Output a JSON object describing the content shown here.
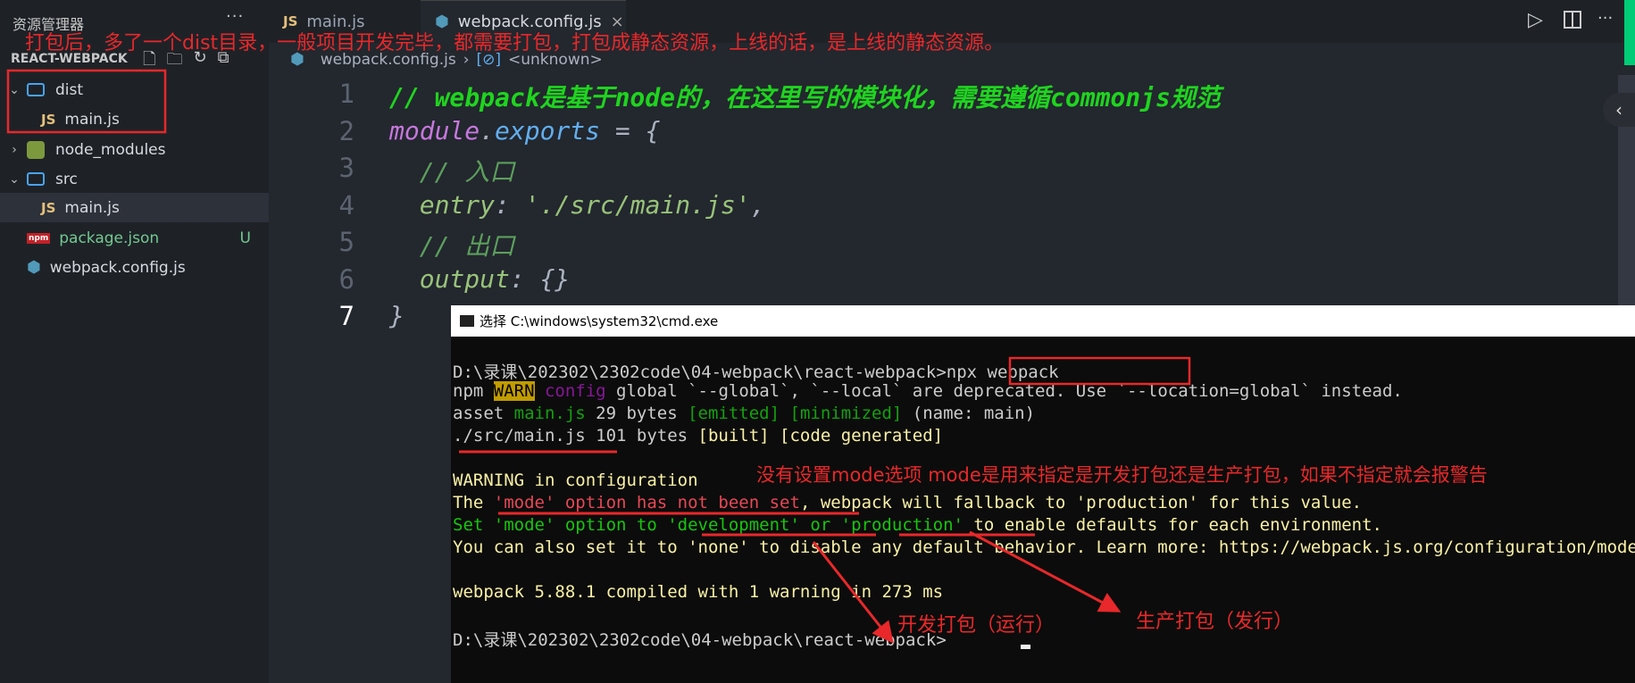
{
  "sidebar": {
    "title": "资源管理器",
    "more": "···",
    "project": "REACT-WEBPACK",
    "items": [
      {
        "label": "dist",
        "type": "folder",
        "expanded": true
      },
      {
        "label": "main.js",
        "type": "js"
      },
      {
        "label": "node_modules",
        "type": "node"
      },
      {
        "label": "src",
        "type": "folder",
        "expanded": true
      },
      {
        "label": "main.js",
        "type": "js"
      },
      {
        "label": "package.json",
        "type": "npm",
        "badge": "U"
      },
      {
        "label": "webpack.config.js",
        "type": "webpack"
      }
    ]
  },
  "tabs": [
    {
      "label": "main.js",
      "icon": "JS"
    },
    {
      "label": "webpack.config.js"
    }
  ],
  "breadcrumb": {
    "file": "webpack.config.js",
    "symbol": "<unknown>"
  },
  "editor": {
    "line_numbers": [
      "1",
      "2",
      "3",
      "4",
      "5",
      "6",
      "7"
    ],
    "lines": [
      [
        {
          "t": "// webpack是基于node的，在这里写的模块化，需要遵循commonjs规范",
          "c": "#1fd41f",
          "b": true
        }
      ],
      [
        {
          "t": "module",
          "c": "#c678dd"
        },
        {
          "t": ".",
          "c": "#abb2bf"
        },
        {
          "t": "exports",
          "c": "#61afef"
        },
        {
          "t": " = {",
          "c": "#abb2bf"
        }
      ],
      [
        {
          "t": "  // 入口",
          "c": "#5c9f5c"
        }
      ],
      [
        {
          "t": "  entry",
          "c": "#98c379"
        },
        {
          "t": ": ",
          "c": "#abb2bf"
        },
        {
          "t": "'./src/main.js'",
          "c": "#98c379"
        },
        {
          "t": ",",
          "c": "#abb2bf"
        }
      ],
      [
        {
          "t": "  // 出口",
          "c": "#5c9f5c"
        }
      ],
      [
        {
          "t": "  output",
          "c": "#98c379"
        },
        {
          "t": ": {}",
          "c": "#abb2bf"
        }
      ],
      [
        {
          "t": "}",
          "c": "#abb2bf"
        }
      ]
    ]
  },
  "terminal": {
    "title": "选择 C:\\windows\\system32\\cmd.exe",
    "lines": [
      [
        {
          "t": "D:\\录课\\202302\\2302code\\04-webpack\\react-webpack>npx webpack",
          "c": "#ccc"
        }
      ],
      [
        {
          "t": "npm ",
          "c": "#ccc"
        },
        {
          "t": "WARN",
          "c": "#000",
          "bg": "#c19c00"
        },
        {
          "t": " config",
          "c": "#881798"
        },
        {
          "t": " global `--global`, `--local` are deprecated. Use `--location=global` instead.",
          "c": "#ccc"
        }
      ],
      [
        {
          "t": "asset ",
          "c": "#ccc"
        },
        {
          "t": "main.js",
          "c": "#13a10e"
        },
        {
          "t": " 29 bytes ",
          "c": "#ccc"
        },
        {
          "t": "[emitted] [minimized]",
          "c": "#13a10e"
        },
        {
          "t": " (name: main)",
          "c": "#ccc"
        }
      ],
      [
        {
          "t": "./src/main.js 101 bytes ",
          "c": "#ccc"
        },
        {
          "t": "[built] [code generated]",
          "c": "#f9f1a5"
        }
      ],
      [
        {
          "t": "",
          "c": "#ccc"
        }
      ],
      [
        {
          "t": "WARNING in configuration",
          "c": "#f9f1a5"
        }
      ],
      [
        {
          "t": "The ",
          "c": "#f9f1a5"
        },
        {
          "t": "'mode' option has not been set",
          "c": "#e74856"
        },
        {
          "t": ", webpack will fallback to 'production' for this value.",
          "c": "#f9f1a5"
        }
      ],
      [
        {
          "t": "Set 'mode' option to 'development' or 'production'",
          "c": "#16c60c"
        },
        {
          "t": " to enable defaults for each environment.",
          "c": "#f9f1a5"
        }
      ],
      [
        {
          "t": "You can also set it to 'none' to disable any default behavior. Learn more: https://webpack.js.org/configuration/mode/",
          "c": "#f9f1a5"
        }
      ],
      [
        {
          "t": "",
          "c": "#ccc"
        }
      ],
      [
        {
          "t": "webpack 5.88.1 compiled with ",
          "c": "#f9f1a5"
        },
        {
          "t": "1 warning",
          "c": "#f9f1a5"
        },
        {
          "t": " in 273 ms",
          "c": "#f9f1a5"
        }
      ],
      [
        {
          "t": "",
          "c": "#ccc"
        }
      ],
      [
        {
          "t": "D:\\录课\\202302\\2302code\\04-webpack\\react-webpack>",
          "c": "#ccc"
        }
      ]
    ]
  },
  "annotations": {
    "top": "打包后，多了一个dist目录，一般项目开发完毕，都需要打包，打包成静态资源，上线的话，是上线的静态资源。",
    "mode": "没有设置mode选项   mode是用来指定是开发打包还是生产打包，如果不指定就会报警告",
    "dev": "开发打包（运行）",
    "prod": "生产打包（发行）",
    "color": "#e8282a"
  }
}
